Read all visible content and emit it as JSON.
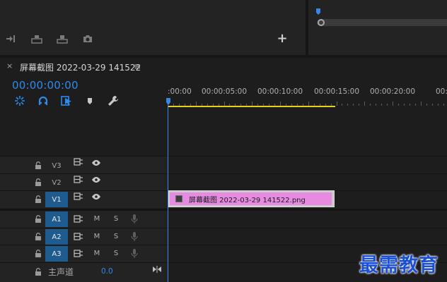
{
  "program_monitor": {
    "add_button": "+"
  },
  "timeline": {
    "close_label": "×",
    "sequence_name": "屏幕截图 2022-03-29 141522",
    "menu_label": "≡",
    "timecode": "00:00:00:00",
    "ruler_labels": [
      ":00:00",
      "00:00:05:00",
      "00:00:10:00",
      "00:00:15:00",
      "00:00:20:00",
      "00:"
    ],
    "tracks": {
      "video": [
        {
          "label": "V3",
          "targeted": false
        },
        {
          "label": "V2",
          "targeted": false
        },
        {
          "label": "V1",
          "targeted": true
        }
      ],
      "audio": [
        {
          "label": "A1",
          "targeted": true,
          "mute": "M",
          "solo": "S"
        },
        {
          "label": "A2",
          "targeted": true,
          "mute": "M",
          "solo": "S"
        },
        {
          "label": "A3",
          "targeted": true,
          "mute": "M",
          "solo": "S"
        }
      ],
      "master": {
        "label": "主声道",
        "value": "0.0"
      }
    },
    "clip": {
      "name": "屏幕截图 2022-03-29  141522.png",
      "color": "#e78be2"
    },
    "playhead_color": "#3a86e8",
    "work_area_color": "#e2d21d"
  },
  "watermark": "最需教育"
}
